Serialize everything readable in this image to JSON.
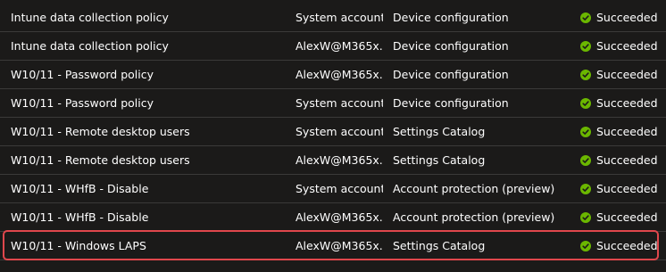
{
  "rows": [
    {
      "name": "Intune data collection policy",
      "user": "System account",
      "type": "Device configuration",
      "status": "Succeeded"
    },
    {
      "name": "Intune data collection policy",
      "user": "AlexW@M365x...",
      "type": "Device configuration",
      "status": "Succeeded"
    },
    {
      "name": "W10/11 - Password policy",
      "user": "AlexW@M365x...",
      "type": "Device configuration",
      "status": "Succeeded"
    },
    {
      "name": "W10/11 - Password policy",
      "user": "System account",
      "type": "Device configuration",
      "status": "Succeeded"
    },
    {
      "name": "W10/11 - Remote desktop users",
      "user": "System account",
      "type": "Settings Catalog",
      "status": "Succeeded"
    },
    {
      "name": "W10/11 - Remote desktop users",
      "user": "AlexW@M365x...",
      "type": "Settings Catalog",
      "status": "Succeeded"
    },
    {
      "name": "W10/11 - WHfB - Disable",
      "user": "System account",
      "type": "Account protection (preview)",
      "status": "Succeeded"
    },
    {
      "name": "W10/11 - WHfB - Disable",
      "user": "AlexW@M365x...",
      "type": "Account protection (preview)",
      "status": "Succeeded"
    },
    {
      "name": "W10/11 - Windows LAPS",
      "user": "AlexW@M365x...",
      "type": "Settings Catalog",
      "status": "Succeeded"
    }
  ],
  "colors": {
    "background": "#1b1a19",
    "row_border": "#3b3a39",
    "success": "#6bb700",
    "highlight": "#e0474c"
  },
  "icons": {
    "status": "checkmark-circle-icon"
  }
}
